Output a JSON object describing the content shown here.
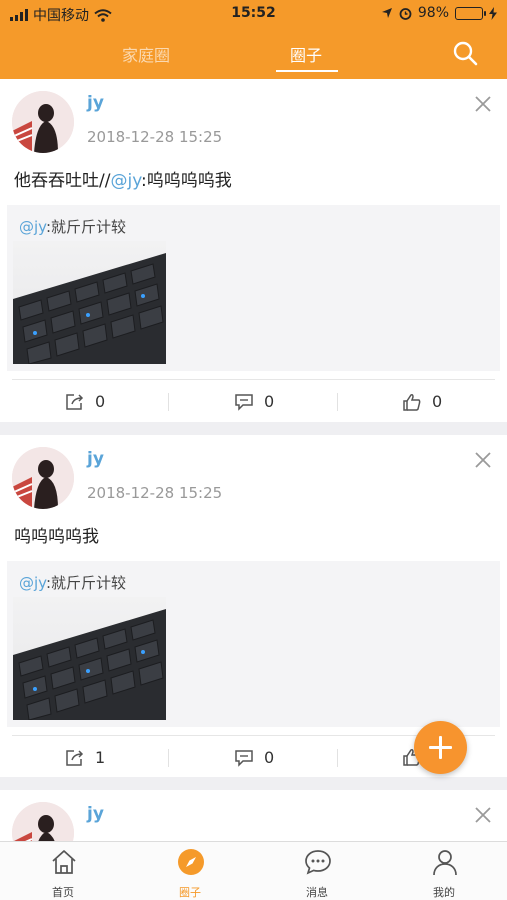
{
  "status_bar": {
    "carrier": "中国移动",
    "time": "15:52",
    "battery": "98%"
  },
  "header": {
    "tabs": [
      {
        "label": "家庭圈",
        "active": false
      },
      {
        "label": "圈子",
        "active": true
      }
    ],
    "search_icon": "search-icon",
    "colors": {
      "bar": "#f59a2a",
      "active_tab": "#ffffff",
      "inactive_tab": "#fbd9b0"
    }
  },
  "posts": [
    {
      "username": "jy",
      "time": "2018-12-28 15:25",
      "content_text": "他吞吞吐吐//",
      "content_mention": "@jy",
      "content_rest": ":呜呜呜呜我",
      "quote_mention": "@jy",
      "quote_text": ":就斤斤计较",
      "share_count": "0",
      "comment_count": "0",
      "like_count": "0"
    },
    {
      "username": "jy",
      "time": "2018-12-28 15:25",
      "content_text": "呜呜呜呜我",
      "quote_mention": "@jy",
      "quote_text": ":就斤斤计较",
      "share_count": "1",
      "comment_count": "0",
      "like_count": ""
    },
    {
      "username": "jy"
    }
  ],
  "fab": {
    "icon": "plus-icon"
  },
  "bottom_nav": [
    {
      "label": "首页",
      "icon": "home-icon",
      "active": false
    },
    {
      "label": "圈子",
      "icon": "compass-icon",
      "active": true
    },
    {
      "label": "消息",
      "icon": "chat-bubble-icon",
      "active": false
    },
    {
      "label": "我的",
      "icon": "person-icon",
      "active": false
    }
  ],
  "colors": {
    "accent": "#f59a2a",
    "mention": "#5aa4d8"
  }
}
